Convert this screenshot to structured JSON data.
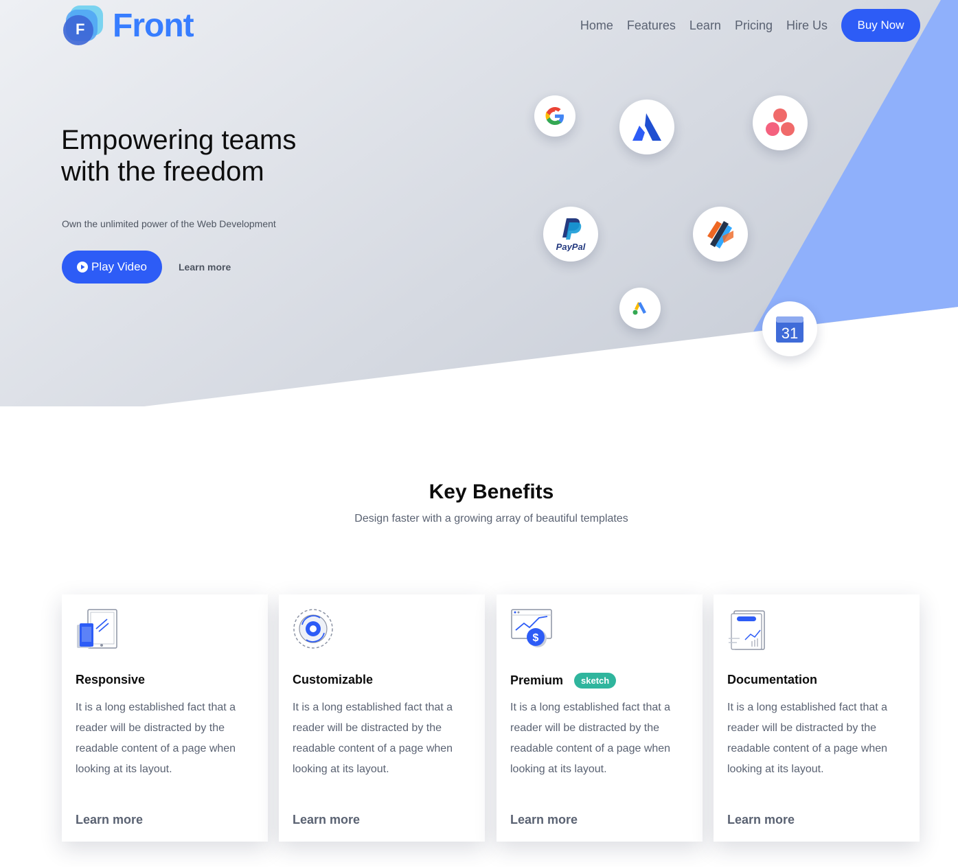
{
  "brand": {
    "name": "Front",
    "logo_letter": "F"
  },
  "nav": {
    "items": [
      "Home",
      "Features",
      "Learn",
      "Pricing",
      "Hire Us"
    ],
    "cta": "Buy Now"
  },
  "hero": {
    "title": "Empowering teams with the freedom",
    "subtitle": "Own the unlimited power of the Web Development",
    "play_label": "Play Video",
    "learn_label": "Learn more",
    "logos": [
      {
        "name": "google-logo",
        "text": "G"
      },
      {
        "name": "atlassian-logo"
      },
      {
        "name": "asana-logo"
      },
      {
        "name": "paypal-logo",
        "text": "PayPal"
      },
      {
        "name": "zeplin-logo"
      },
      {
        "name": "google-ads-logo"
      },
      {
        "name": "google-calendar-logo",
        "text": "31"
      }
    ]
  },
  "benefits": {
    "title": "Key Benefits",
    "subtitle": "Design faster with a growing array of beautiful templates",
    "cards": [
      {
        "title": "Responsive",
        "icon": "responsive-devices-icon",
        "text": "It is a long established fact that a reader will be distracted by the readable content of a page when looking at its layout.",
        "link": "Learn more"
      },
      {
        "title": "Customizable",
        "icon": "gear-icon",
        "text": "It is a long established fact that a reader will be distracted by the readable content of a page when looking at its layout.",
        "link": "Learn more"
      },
      {
        "title": "Premium",
        "badge": "sketch",
        "icon": "premium-chart-dollar-icon",
        "text": "It is a long established fact that a reader will be distracted by the readable content of a page when looking at its layout.",
        "link": "Learn more"
      },
      {
        "title": "Documentation",
        "icon": "document-chart-icon",
        "text": "It is a long established fact that a reader will be distracted by the readable content of a page when looking at its layout.",
        "link": "Learn more"
      }
    ]
  },
  "colors": {
    "primary": "#2d5cf6",
    "brand_blue": "#377dff",
    "accent_blue": "#8fb0fb",
    "badge_green": "#2fb59d"
  }
}
